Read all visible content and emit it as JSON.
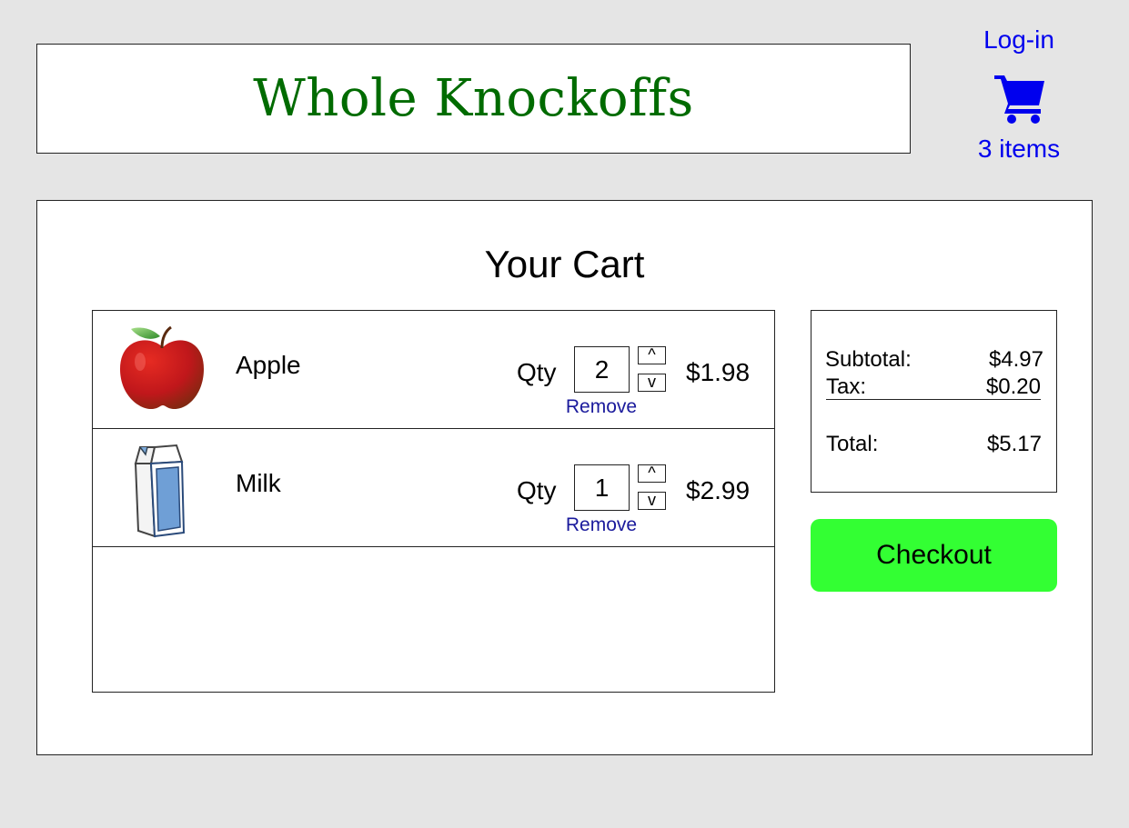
{
  "header": {
    "brand": "Whole Knockoffs",
    "login_label": "Log-in",
    "cart_icon": "shopping-cart-icon",
    "cart_count": "3 items"
  },
  "cart": {
    "title": "Your Cart",
    "qty_label": "Qty",
    "remove_label": "Remove",
    "step_up_label": "^",
    "step_down_label": "v",
    "items": [
      {
        "name": "Apple",
        "icon": "apple-icon",
        "qty": "2",
        "price": "$1.98"
      },
      {
        "name": "Milk",
        "icon": "milk-carton-icon",
        "qty": "1",
        "price": "$2.99"
      }
    ]
  },
  "summary": {
    "subtotal_label": "Subtotal:",
    "subtotal_value": "$4.97",
    "tax_label": "Tax:",
    "tax_value": "$0.20",
    "total_label": "Total:",
    "total_value": "$5.17"
  },
  "checkout_label": "Checkout",
  "colors": {
    "background": "#e5e5e5",
    "brand_green": "#006b00",
    "link_blue": "#0000ee",
    "checkout_green": "#33ff33"
  }
}
